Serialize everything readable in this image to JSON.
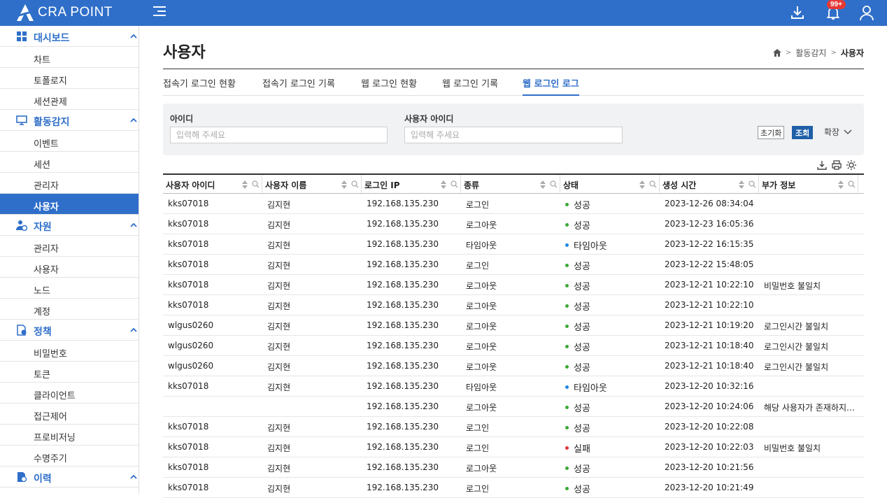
{
  "app": {
    "logo_text": "CRA POINT",
    "notification_badge": "99+",
    "accent_color": "#2f6fc9"
  },
  "sidebar": {
    "groups": [
      {
        "label": "대시보드",
        "icon": "dashboard-grid-icon",
        "items": [
          {
            "label": "차트"
          },
          {
            "label": "토폴로지"
          },
          {
            "label": "세션관제"
          }
        ]
      },
      {
        "label": "활동감지",
        "icon": "monitor-icon",
        "items": [
          {
            "label": "이벤트"
          },
          {
            "label": "세션"
          },
          {
            "label": "관리자"
          },
          {
            "label": "사용자",
            "active": true
          }
        ]
      },
      {
        "label": "자원",
        "icon": "user-settings-icon",
        "items": [
          {
            "label": "관리자"
          },
          {
            "label": "사용자"
          },
          {
            "label": "노드"
          },
          {
            "label": "계정"
          }
        ]
      },
      {
        "label": "정책",
        "icon": "policy-document-icon",
        "items": [
          {
            "label": "비밀번호"
          },
          {
            "label": "토큰"
          },
          {
            "label": "클라이언트"
          },
          {
            "label": "접근제어"
          },
          {
            "label": "프로비저닝"
          },
          {
            "label": "수명주기"
          }
        ]
      },
      {
        "label": "이력",
        "icon": "history-document-icon",
        "items": []
      }
    ]
  },
  "page": {
    "title": "사용자",
    "breadcrumb": {
      "parent": "활동감지",
      "current": "사용자"
    }
  },
  "tabs": [
    {
      "label": "접속기 로그인 현황"
    },
    {
      "label": "접속기 로그인 기록"
    },
    {
      "label": "웹 로그인 현황"
    },
    {
      "label": "웹 로그인 기록"
    },
    {
      "label": "웹 로그인 로그",
      "active": true
    }
  ],
  "filter": {
    "id_label": "아이디",
    "id_placeholder": "입력해 주세요",
    "user_id_label": "사용자 아이디",
    "user_id_placeholder": "입력해 주세요",
    "reset_label": "초기화",
    "search_label": "조회",
    "expand_label": "확장"
  },
  "table": {
    "columns": [
      "사용자 아이디",
      "사용자 이름",
      "로그인 IP",
      "종류",
      "상태",
      "생성 시간",
      "부가 정보"
    ],
    "status_colors": {
      "성공": "#3aaa35",
      "타임아웃": "#1e88e5",
      "실패": "#e53935"
    },
    "rows": [
      [
        "kks07018",
        "김지현",
        "192.168.135.230",
        "로그인",
        "성공",
        "2023-12-26 08:34:04",
        ""
      ],
      [
        "kks07018",
        "김지현",
        "192.168.135.230",
        "로그아웃",
        "성공",
        "2023-12-23 16:05:36",
        ""
      ],
      [
        "kks07018",
        "김지현",
        "192.168.135.230",
        "타임아웃",
        "타임아웃",
        "2023-12-22 16:15:35",
        ""
      ],
      [
        "kks07018",
        "김지현",
        "192.168.135.230",
        "로그인",
        "성공",
        "2023-12-22 15:48:05",
        ""
      ],
      [
        "kks07018",
        "김지현",
        "192.168.135.230",
        "로그아웃",
        "성공",
        "2023-12-21 10:22:10",
        "비밀번호 불일치"
      ],
      [
        "kks07018",
        "김지현",
        "192.168.135.230",
        "로그아웃",
        "성공",
        "2023-12-21 10:22:10",
        ""
      ],
      [
        "wlgus0260",
        "김지현",
        "192.168.135.230",
        "로그아웃",
        "성공",
        "2023-12-21 10:19:20",
        "로그인시간 불일치"
      ],
      [
        "wlgus0260",
        "김지현",
        "192.168.135.230",
        "로그아웃",
        "성공",
        "2023-12-21 10:18:40",
        "로그인시간 불일치"
      ],
      [
        "wlgus0260",
        "김지현",
        "192.168.135.230",
        "로그아웃",
        "성공",
        "2023-12-21 10:18:40",
        "로그인시간 불일치"
      ],
      [
        "kks07018",
        "김지현",
        "192.168.135.230",
        "타임아웃",
        "타임아웃",
        "2023-12-20 10:32:16",
        ""
      ],
      [
        "",
        "",
        "192.168.135.230",
        "로그아웃",
        "성공",
        "2023-12-20 10:24:06",
        "해당 사용자가 존재하지…"
      ],
      [
        "kks07018",
        "김지현",
        "192.168.135.230",
        "로그인",
        "성공",
        "2023-12-20 10:22:08",
        ""
      ],
      [
        "kks07018",
        "김지현",
        "192.168.135.230",
        "로그인",
        "실패",
        "2023-12-20 10:22:03",
        "비밀번호 불일치"
      ],
      [
        "kks07018",
        "김지현",
        "192.168.135.230",
        "로그아웃",
        "성공",
        "2023-12-20 10:21:56",
        ""
      ],
      [
        "kks07018",
        "김지현",
        "192.168.135.230",
        "로그인",
        "성공",
        "2023-12-20 10:21:49",
        ""
      ]
    ]
  }
}
